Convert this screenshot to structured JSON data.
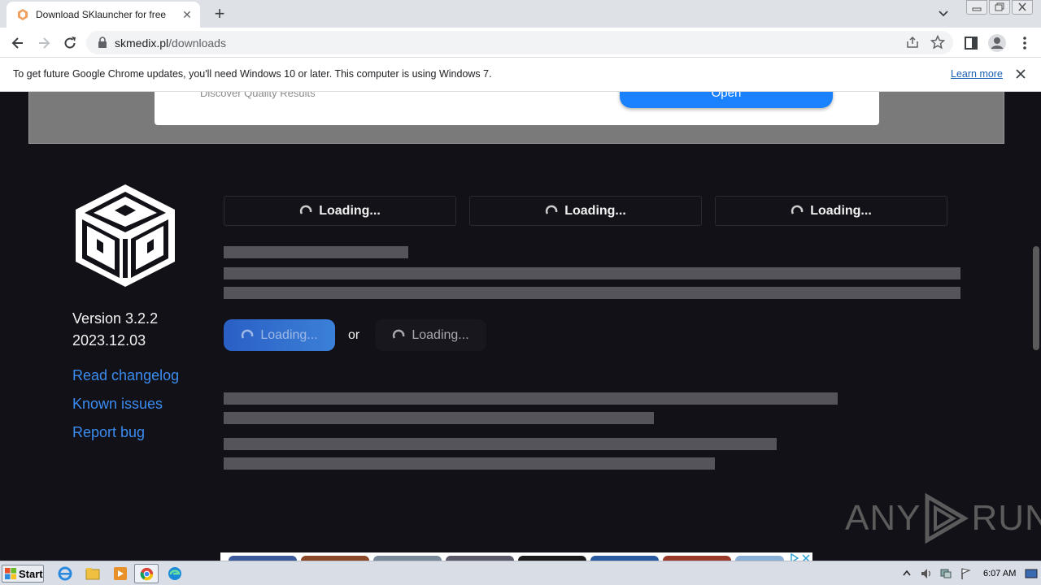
{
  "browser": {
    "tab_title": "Download SKlauncher for free",
    "url_host": "skmedix.pl",
    "url_path": "/downloads"
  },
  "infobar": {
    "message": "To get future Google Chrome updates, you'll need Windows 10 or later. This computer is using Windows 7.",
    "learn_more": "Learn more"
  },
  "ad_banner": {
    "text": "Discover Quality Results",
    "button": "Open"
  },
  "sidebar": {
    "version": "Version 3.2.2",
    "date": "2023.12.03",
    "links": [
      "Read changelog",
      "Known issues",
      "Report bug"
    ]
  },
  "main": {
    "loading_boxes": [
      "Loading...",
      "Loading...",
      "Loading..."
    ],
    "primary_download": "Loading...",
    "or_label": "or",
    "secondary_download": "Loading..."
  },
  "watermark": {
    "left": "ANY",
    "right": "RUN"
  },
  "taskbar": {
    "start": "Start",
    "clock": "6:07 AM"
  },
  "colors": {
    "page_bg": "#111117",
    "link": "#3b8cf0",
    "primary_button": "#2a5fc4",
    "ad_button": "#1a82ff"
  }
}
